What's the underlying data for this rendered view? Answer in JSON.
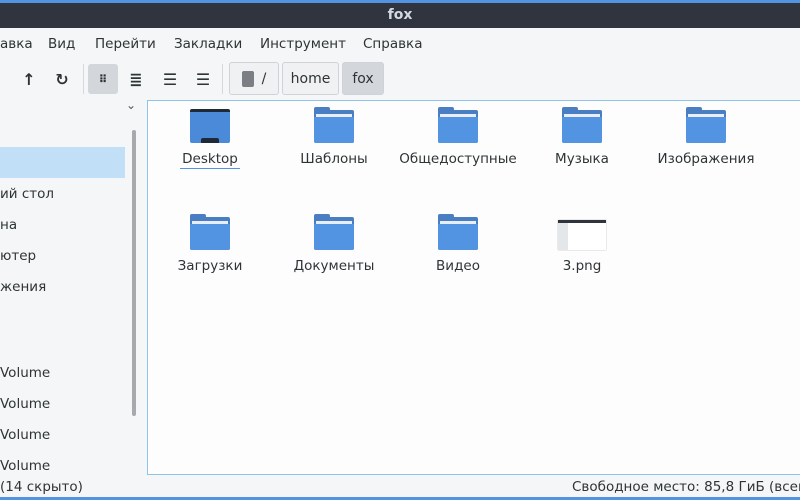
{
  "title": "fox",
  "menu": [
    "авка",
    "Вид",
    "Перейти",
    "Закладки",
    "Инструмент",
    "Справка"
  ],
  "breadcrumb": [
    "/",
    "home",
    "fox"
  ],
  "sidebar": [
    "ий стол",
    "на",
    "ютер",
    "жения",
    "Volume",
    "Volume",
    "Volume",
    "Volume"
  ],
  "files": [
    {
      "name": "Desktop",
      "type": "desktop"
    },
    {
      "name": "Шаблоны",
      "type": "folder"
    },
    {
      "name": "Общедоступные",
      "type": "folder"
    },
    {
      "name": "Музыка",
      "type": "folder"
    },
    {
      "name": "Изображения",
      "type": "folder"
    },
    {
      "name": "Загрузки",
      "type": "folder"
    },
    {
      "name": "Документы",
      "type": "folder"
    },
    {
      "name": "Видео",
      "type": "folder"
    },
    {
      "name": "3.png",
      "type": "image"
    }
  ],
  "status": {
    "left": "(14 скрыто)",
    "right": "Свободное место: 85,8 ГиБ (всего"
  },
  "colors": {
    "accent": "#5294e2",
    "titlebar": "#2f343f"
  }
}
